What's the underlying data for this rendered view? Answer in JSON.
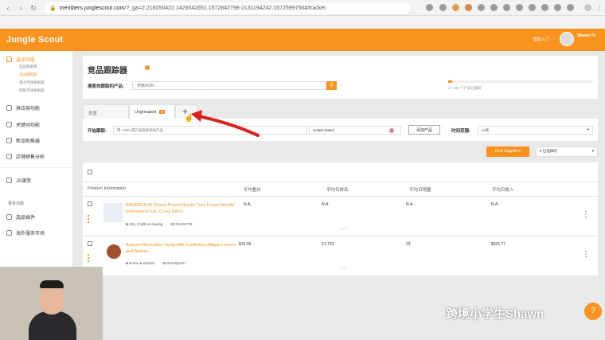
{
  "browser": {
    "url_host": "members.junglescout.com",
    "url_rest": "/?_ga=2.216050422.1426542651.1572842798-2131194242.1572599756#/tracker"
  },
  "header": {
    "logo": "Jungle Scout",
    "link": "帮助入门",
    "user_name": "Shawn Ye"
  },
  "sidebar": {
    "items": [
      {
        "label": "选品功能",
        "active": true
      },
      {
        "label": "供应商功能"
      },
      {
        "label": "关键词功能"
      },
      {
        "label": "新品助推器"
      },
      {
        "label": "店铺销售分析"
      },
      {
        "label": "JS课堂"
      },
      {
        "label": "选品插件"
      },
      {
        "label": "海外服务市场"
      }
    ],
    "subitems": [
      {
        "label": "选品数据库"
      },
      {
        "label": "竞品跟踪器",
        "active": true
      },
      {
        "label": "潜力市场搜索器"
      },
      {
        "label": "利基市场搜索器"
      }
    ],
    "more_label": "更多功能"
  },
  "tracker": {
    "title": "竞品跟踪器",
    "search_label": "搜索你跟踪的产品:",
    "search_placeholder": "搜索ASIN",
    "progress_text": "3 / 100 个产品已跟踪",
    "progress_pct": 3
  },
  "tabs": {
    "all": "总览",
    "ungrouped": "Ungrouped",
    "ungrouped_count": "2",
    "add": "+"
  },
  "add_row": {
    "label": "开始跟踪:",
    "input_placeholder": "用 ASIN 或产品链接添加产品",
    "marketplace": "United States",
    "add_button": "添加产品",
    "range_label": "时间范围:",
    "range_value": "14天"
  },
  "actions": {
    "find_suppliers": "Find Suppliers",
    "selected": "0 已选择的"
  },
  "table": {
    "columns": [
      "Product Information",
      "平均售价",
      "平均日排名",
      "平均日销量",
      "平均日收入"
    ],
    "rows": [
      {
        "title": "BAGERLA 18 Pieces Punch Needle Tool, Punch Needle Embroidery Kits, Cross Stitch...",
        "category": "Arts, Crafts & Sewing",
        "asin": "B07XK2X778",
        "price": "N.A.",
        "rank": "N.A.",
        "sales": "N.A.",
        "revenue": "N.A."
      },
      {
        "title": "Autumn Decorative Swag with Sunflowers,Maple Leaves and Berries,...",
        "category": "Home & Kitchen",
        "asin": "B07XNJQHH7",
        "price": "$15.99",
        "rank": "21,723",
        "sales": "23",
        "revenue": "$321.77"
      }
    ]
  },
  "watermark": "跨境小学生Shawn"
}
